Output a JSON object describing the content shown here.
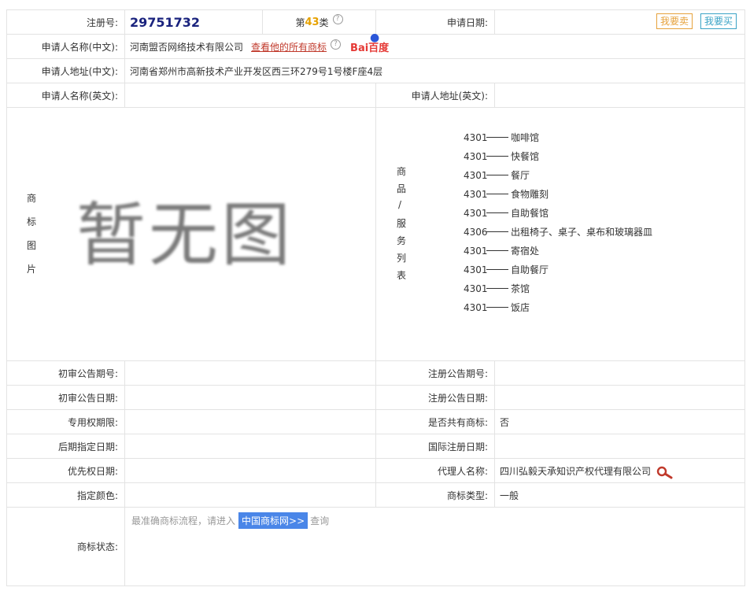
{
  "header": {
    "reg_no_label": "注册号:",
    "reg_no": "29751732",
    "class_prefix": "第",
    "class_num": "43",
    "class_suffix": "类",
    "apply_date_label": "申请日期:",
    "btn_sell": "我要卖",
    "btn_buy": "我要买"
  },
  "applicant": {
    "name_cn_label": "申请人名称(中文):",
    "name_cn": "河南盟否网络技术有限公司",
    "view_all_link": "查看他的所有商标",
    "baidu_logo_text": "Bai百度",
    "addr_cn_label": "申请人地址(中文):",
    "addr_cn": "河南省郑州市高新技术产业开发区西三环279号1号楼F座4层",
    "name_en_label": "申请人名称(英文):",
    "addr_en_label": "申请人地址(英文):"
  },
  "image_section": {
    "label_chars": [
      "商",
      "标",
      "图",
      "片"
    ],
    "placeholder": "暂无图"
  },
  "goods_section": {
    "label_chars": [
      "商",
      "品",
      "/",
      "服",
      "务",
      "列",
      "表"
    ],
    "items": [
      {
        "code": "4301",
        "name": "咖啡馆"
      },
      {
        "code": "4301",
        "name": "快餐馆"
      },
      {
        "code": "4301",
        "name": "餐厅"
      },
      {
        "code": "4301",
        "name": "食物雕刻"
      },
      {
        "code": "4301",
        "name": "自助餐馆"
      },
      {
        "code": "4306",
        "name": "出租椅子、桌子、桌布和玻璃器皿"
      },
      {
        "code": "4301",
        "name": "寄宿处"
      },
      {
        "code": "4301",
        "name": "自助餐厅"
      },
      {
        "code": "4301",
        "name": "茶馆"
      },
      {
        "code": "4301",
        "name": "饭店"
      }
    ]
  },
  "details": {
    "prelim_pub_no_label": "初审公告期号:",
    "reg_pub_no_label": "注册公告期号:",
    "prelim_pub_date_label": "初审公告日期:",
    "reg_pub_date_label": "注册公告日期:",
    "exclusive_period_label": "专用权期限:",
    "shared_label": "是否共有商标:",
    "shared_value": "否",
    "later_date_label": "后期指定日期:",
    "intl_reg_date_label": "国际注册日期:",
    "priority_date_label": "优先权日期:",
    "agent_label": "代理人名称:",
    "agent_value": "四川弘毅天承知识产权代理有限公司",
    "color_label": "指定颜色:",
    "type_label": "商标类型:",
    "type_value": "一般"
  },
  "status": {
    "label": "商标状态:",
    "hint": "最准确商标流程，请进入",
    "link": "中国商标网>>",
    "suffix": "查询"
  },
  "colors": {
    "reg_no": "#1a237e",
    "class_num": "#e6a100",
    "link_red": "#c0392b",
    "sell_btn": "#e6a23c",
    "buy_btn": "#3aa3c6",
    "status_link_bg": "#4a86e8"
  }
}
